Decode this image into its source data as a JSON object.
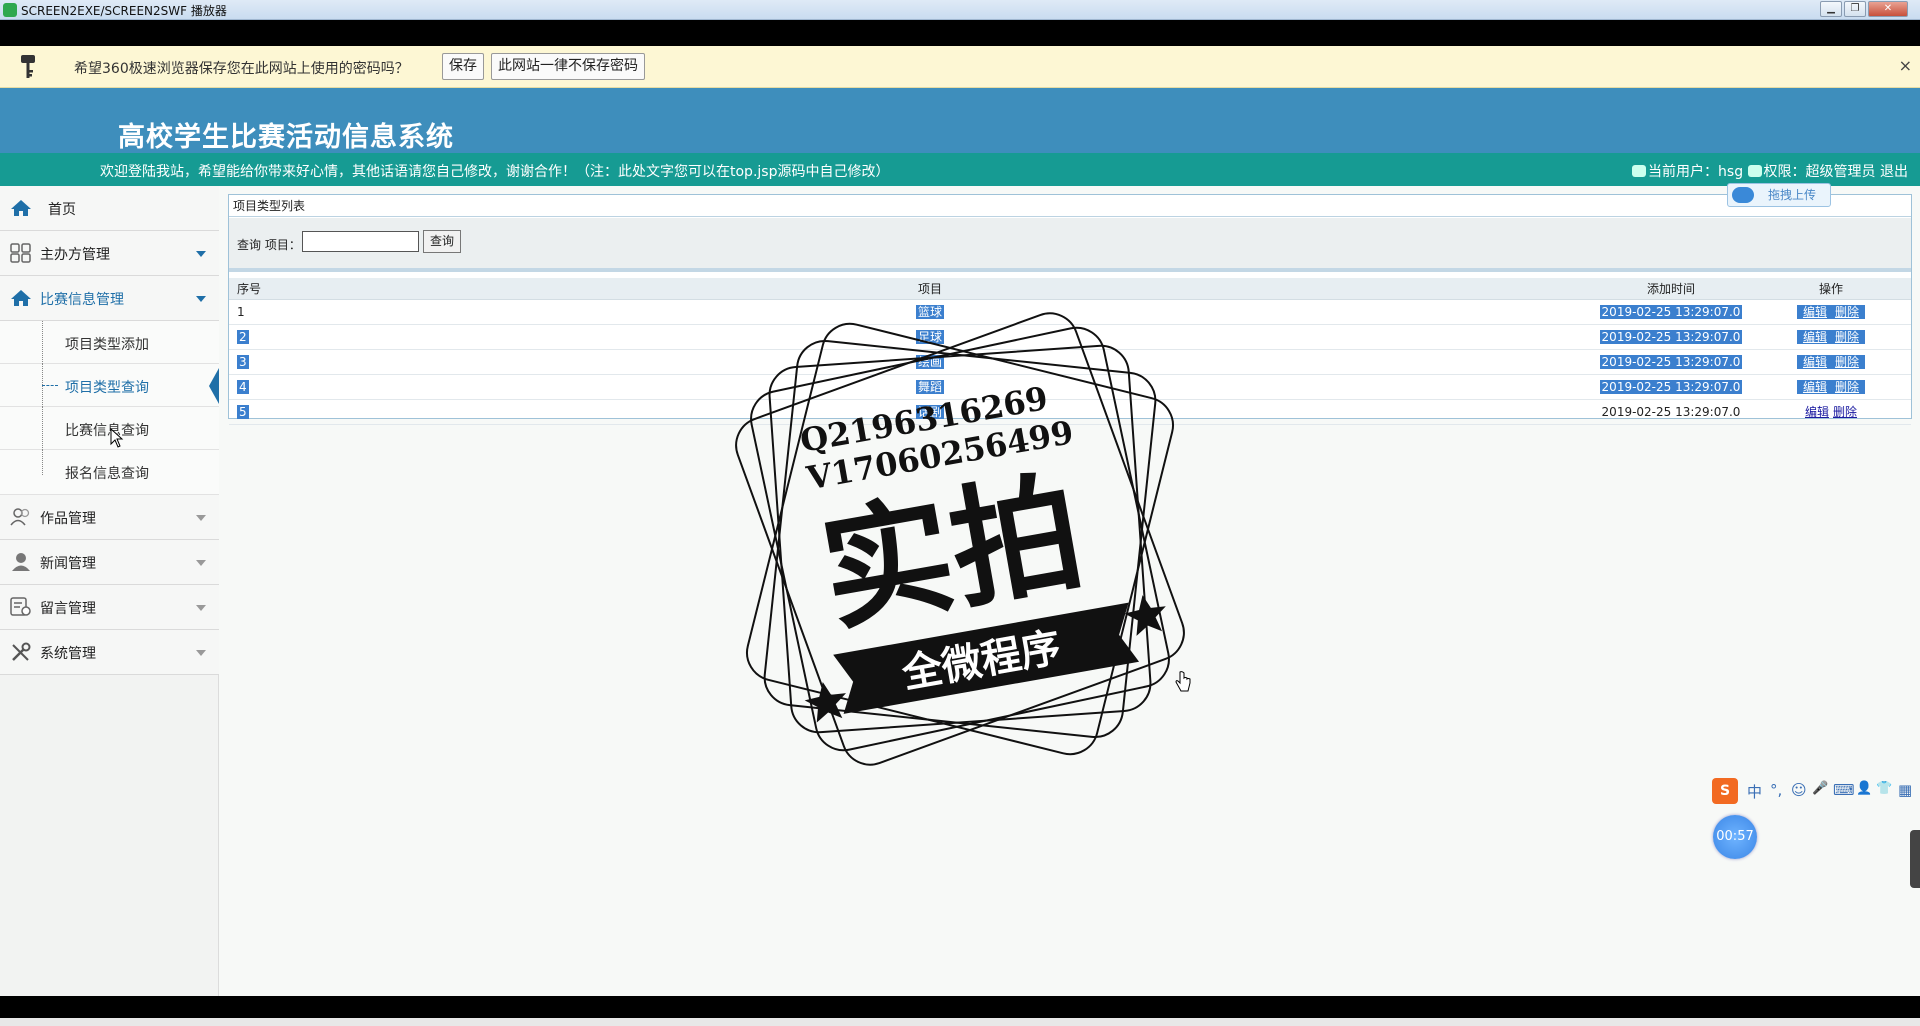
{
  "window": {
    "title": "SCREEN2EXE/SCREEN2SWF 播放器",
    "minimize": "▁",
    "maximize": "❐",
    "close": "✕"
  },
  "password_bar": {
    "message": "希望360极速浏览器保存您在此网站上使用的密码吗？",
    "save_label": "保存",
    "never_label": "此网站一律不保存密码",
    "close": "×"
  },
  "header": {
    "system_title": "高校学生比赛活动信息系统",
    "welcome": "欢迎登陆我站，希望能给你带来好心情，其他话语请您自己修改，谢谢合作！（注：此处文字您可以在top.jsp源码中自己修改）",
    "current_user": "当前用户：hsg",
    "permission": "权限：超级管理员",
    "logout": "退出"
  },
  "sidebar": {
    "home": "首页",
    "sponsor": "主办方管理",
    "contest": "比赛信息管理",
    "contest_items": [
      "项目类型添加",
      "项目类型查询",
      "比赛信息查询",
      "报名信息查询"
    ],
    "works": "作品管理",
    "news": "新闻管理",
    "messages": "留言管理",
    "system": "系统管理"
  },
  "panel": {
    "title": "项目类型列表",
    "search_label": "查询 项目：",
    "search_value": "",
    "search_button": "查询"
  },
  "table": {
    "headers": [
      "序号",
      "项目",
      "添加时间",
      "操作"
    ],
    "rows": [
      {
        "no": "1",
        "project": "篮球",
        "time": "2019-02-25 13:29:07.0",
        "edit": "编辑",
        "delete": "删除"
      },
      {
        "no": "2",
        "project": "足球",
        "time": "2019-02-25 13:29:07.0",
        "edit": "编辑",
        "delete": "删除"
      },
      {
        "no": "3",
        "project": "绘画",
        "time": "2019-02-25 13:29:07.0",
        "edit": "编辑",
        "delete": "删除"
      },
      {
        "no": "4",
        "project": "舞蹈",
        "time": "2019-02-25 13:29:07.0",
        "edit": "编辑",
        "delete": "删除"
      },
      {
        "no": "5",
        "project": "话剧",
        "time": "2019-02-25 13:29:07.0",
        "edit": "编辑",
        "delete": "删除"
      }
    ]
  },
  "upload_float": "拖拽上传",
  "watermark": {
    "line1": "Q2196316269",
    "line2": "V17060256499",
    "main": "实拍",
    "ribbon": "全微程序"
  },
  "ime": {
    "logo": "S",
    "mode": "中",
    "punct": "°,",
    "emoji": "☺",
    "mic": "🎤",
    "keyboard": "⌨",
    "user": "👤",
    "skin": "👕",
    "menu": "▦"
  },
  "timer": "00:57",
  "colors": {
    "header": "#3e8ebc",
    "subheader": "#169b93",
    "accent": "#1f6fa8",
    "selection": "#3b7fce"
  }
}
